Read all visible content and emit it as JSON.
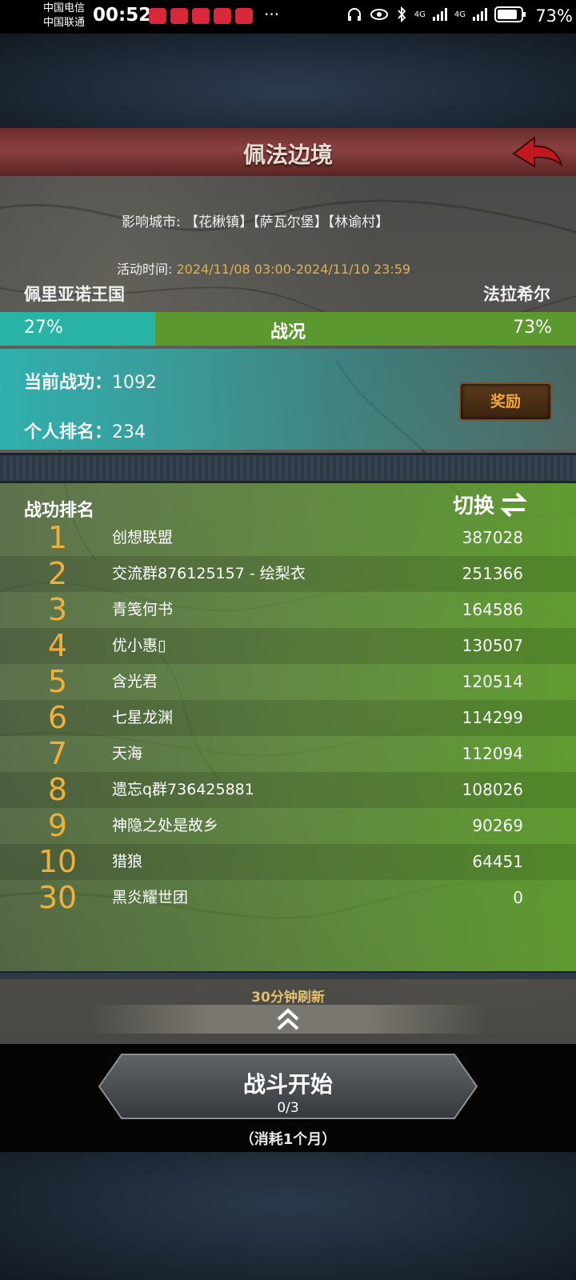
{
  "status_bar": {
    "carrier1": "中国电信",
    "carrier2": "中国联通",
    "time": "00:52",
    "more": "···",
    "network1": "4G",
    "network2": "4G",
    "battery": "73%"
  },
  "header": {
    "title": "佩法边境"
  },
  "event_info": {
    "city_label": "影响城市:",
    "cities": "【花楸镇】【萨瓦尔堡】【林谕村】",
    "time_label": "活动时间:",
    "time_value": "2024/11/08 03:00-2024/11/10 23:59"
  },
  "factions": {
    "left_name": "佩里亚诺王国",
    "right_name": "法拉希尔",
    "left_percent": "27%",
    "right_percent": "73%",
    "left_share": 0.27,
    "label": "战况",
    "left_color": "#29b3a5",
    "right_color": "#5c9830"
  },
  "personal": {
    "merit_label": "当前战功：",
    "merit_value": "1092",
    "rank_label": "个人排名：",
    "rank_value": "234",
    "reward_button": "奖励"
  },
  "ranking": {
    "title": "战功排名",
    "switch_label": "切换",
    "rows": [
      {
        "rank": "1",
        "name": "创想联盟",
        "score": "387028"
      },
      {
        "rank": "2",
        "name": "交流群876125157 - 绘梨衣",
        "score": "251366"
      },
      {
        "rank": "3",
        "name": "青笺何书",
        "score": "164586"
      },
      {
        "rank": "4",
        "name": "优小惠▯",
        "score": "130507"
      },
      {
        "rank": "5",
        "name": "含光君",
        "score": "120514"
      },
      {
        "rank": "6",
        "name": "七星龙渊",
        "score": "114299"
      },
      {
        "rank": "7",
        "name": "天海",
        "score": "112094"
      },
      {
        "rank": "8",
        "name": "遗忘q群736425881",
        "score": "108026"
      },
      {
        "rank": "9",
        "name": "神隐之处是故乡",
        "score": "90269"
      },
      {
        "rank": "10",
        "name": "猎狼",
        "score": "64451"
      },
      {
        "rank": "30",
        "name": "黑炎耀世团",
        "score": "0"
      }
    ]
  },
  "footer": {
    "refresh_text": "30分钟刷新",
    "battle_button": "战斗开始",
    "battle_count": "0/3",
    "battle_cost": "（消耗1个月）"
  }
}
